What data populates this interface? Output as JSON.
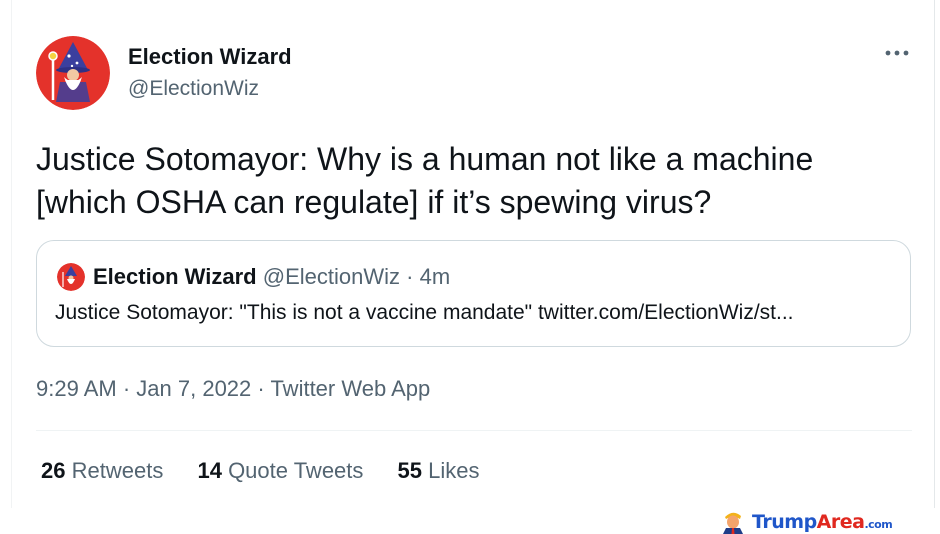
{
  "tweet": {
    "author_name": "Election Wizard",
    "author_handle": "@ElectionWiz",
    "more_icon": "more-horizontal-icon",
    "text": "Justice Sotomayor: Why is a human not like a machine [which OSHA can regulate] if it’s spewing virus?",
    "quote": {
      "author_name": "Election Wizard",
      "author_handle": "@ElectionWiz",
      "separator": "·",
      "time": "4m",
      "text": "Justice Sotomayor: \"This is not a vaccine mandate\" twitter.com/ElectionWiz/st..."
    },
    "meta": {
      "time": "9:29 AM",
      "sep1": "·",
      "date": "Jan 7, 2022",
      "sep2": "·",
      "app": "Twitter Web App"
    },
    "stats": [
      {
        "count": "26",
        "label": "Retweets"
      },
      {
        "count": "14",
        "label": "Quote Tweets"
      },
      {
        "count": "55",
        "label": "Likes"
      }
    ]
  },
  "watermark": {
    "part1": "Trump",
    "part2": "Area",
    "part3": ".com"
  },
  "colors": {
    "avatar_bg": "#e4322b",
    "link_blue": "#1f56c9",
    "muted": "#536471"
  }
}
